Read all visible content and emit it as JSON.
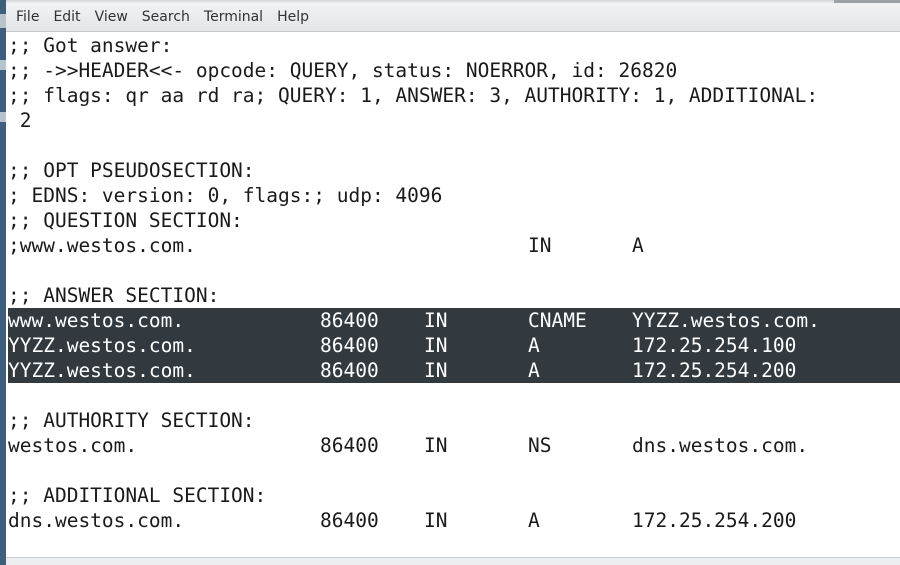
{
  "menubar": {
    "items": [
      "File",
      "Edit",
      "View",
      "Search",
      "Terminal",
      "Help"
    ]
  },
  "terminal": {
    "header_lines": [
      ";; Got answer:",
      ";; ->>HEADER<<- opcode: QUERY, status: NOERROR, id: 26820",
      ";; flags: qr aa rd ra; QUERY: 1, ANSWER: 3, AUTHORITY: 1, ADDITIONAL:",
      " 2",
      "",
      ";; OPT PSEUDOSECTION:",
      "; EDNS: version: 0, flags:; udp: 4096",
      ";; QUESTION SECTION:"
    ],
    "question": {
      "name": ";www.westos.com.",
      "class": "IN",
      "type": "A"
    },
    "answer_heading": ";; ANSWER SECTION:",
    "answer_records": [
      {
        "name": "www.westos.com.",
        "ttl": "86400",
        "class": "IN",
        "type": "CNAME",
        "data": "YYZZ.westos.com."
      },
      {
        "name": "YYZZ.westos.com.",
        "ttl": "86400",
        "class": "IN",
        "type": "A",
        "data": "172.25.254.100"
      },
      {
        "name": "YYZZ.westos.com.",
        "ttl": "86400",
        "class": "IN",
        "type": "A",
        "data": "172.25.254.200"
      }
    ],
    "authority_heading": ";; AUTHORITY SECTION:",
    "authority_records": [
      {
        "name": "westos.com.",
        "ttl": "86400",
        "class": "IN",
        "type": "NS",
        "data": "dns.westos.com."
      }
    ],
    "additional_heading": ";; ADDITIONAL SECTION:",
    "additional_records": [
      {
        "name": "dns.westos.com.",
        "ttl": "86400",
        "class": "IN",
        "type": "A",
        "data": "172.25.254.200"
      }
    ],
    "selection_color": "#323a40",
    "background_color": "#ffffff",
    "text_color": "#1a1a1a"
  }
}
